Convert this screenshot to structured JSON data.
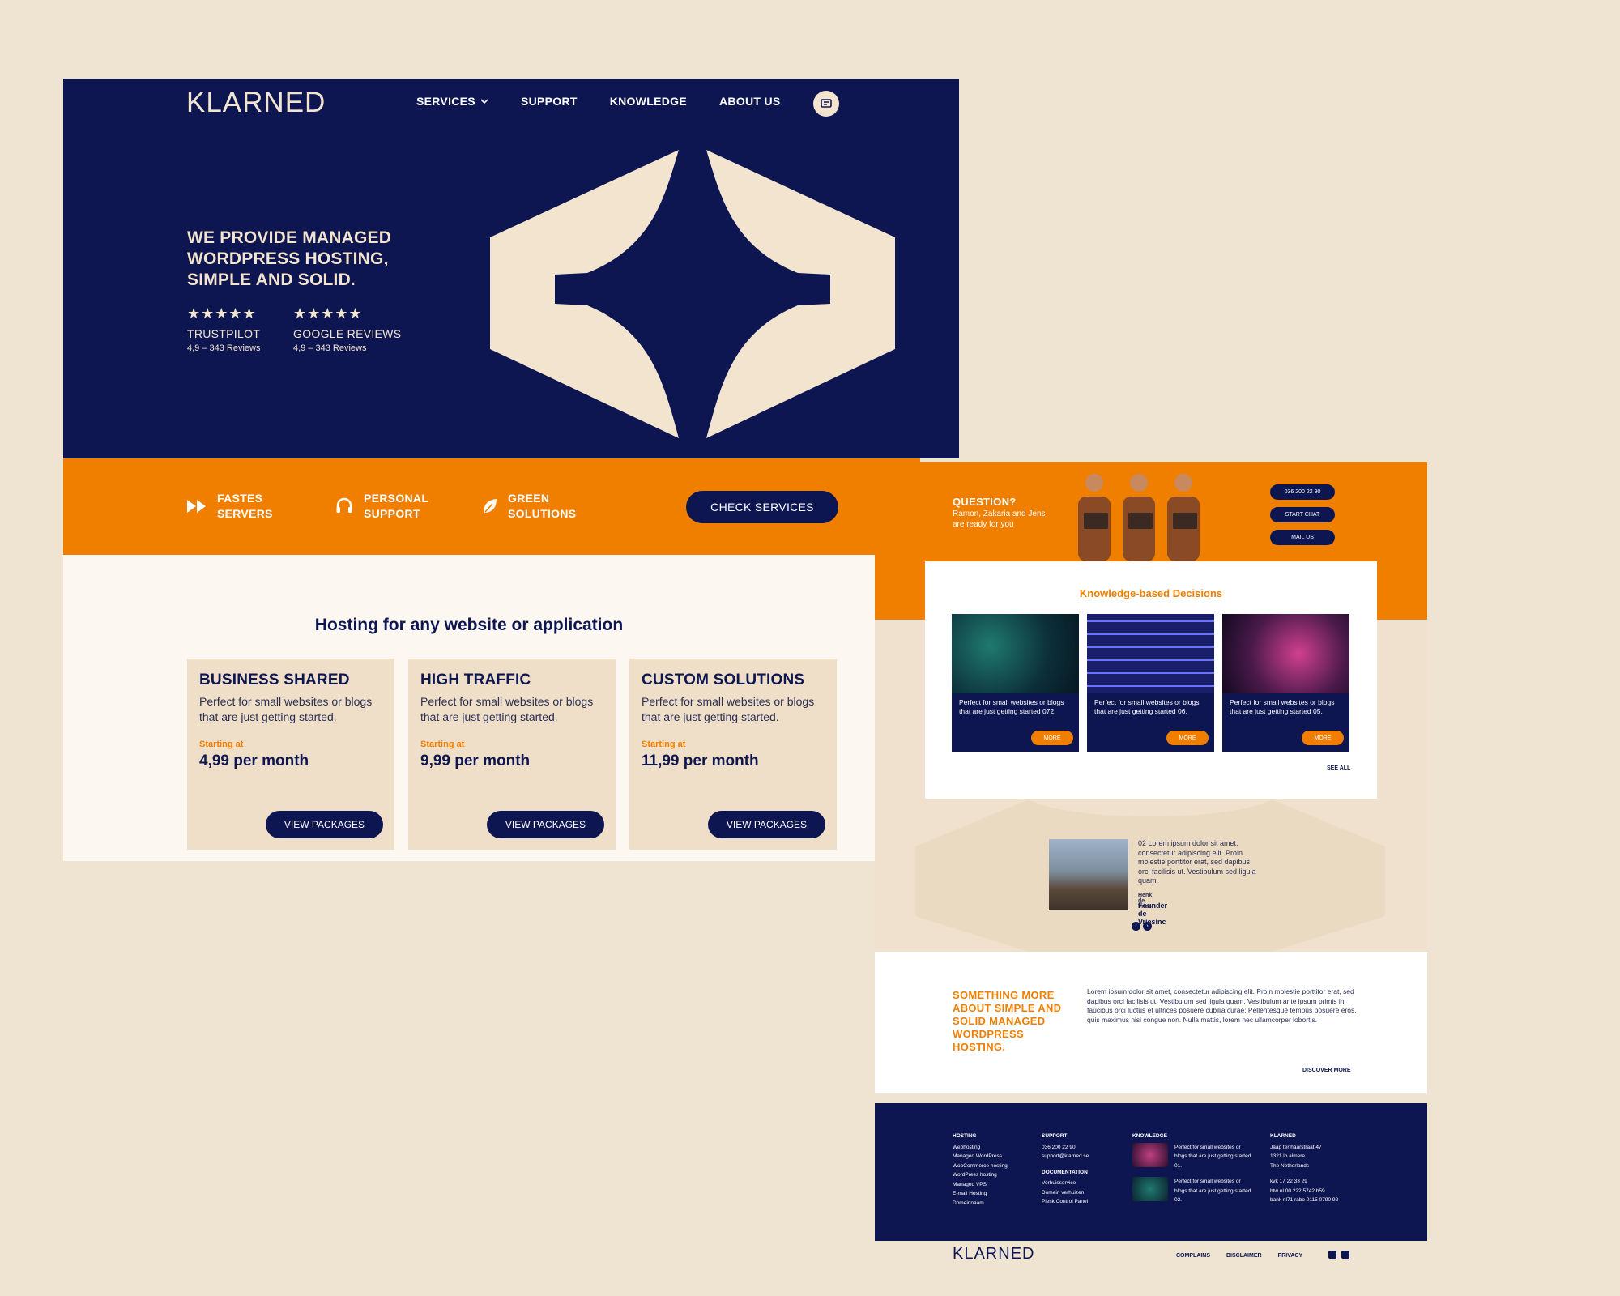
{
  "brand": {
    "name": "KLARNED"
  },
  "colors": {
    "navy": "#0d1650",
    "orange": "#f07f00",
    "cream": "#f2e4cf",
    "background": "#efe3d2"
  },
  "nav": {
    "items": [
      {
        "label": "SERVICES",
        "has_dropdown": true
      },
      {
        "label": "SUPPORT"
      },
      {
        "label": "KNOWLEDGE"
      },
      {
        "label": "ABOUT US"
      }
    ],
    "cart_icon": "cart-icon"
  },
  "hero": {
    "title": "WE PROVIDE MANAGED WORDPRESS HOSTING, SIMPLE AND SOLID.",
    "reviews": [
      {
        "stars": "★★★★★",
        "rating": 5,
        "name": "TRUSTPILOT",
        "count": "4,9 – 343 Reviews"
      },
      {
        "stars": "★★★★★",
        "rating": 5,
        "name": "GOOGLE REVIEWS",
        "count": "4,9 – 343 Reviews"
      }
    ]
  },
  "features": {
    "items": [
      {
        "icon": "fast-forward-icon",
        "line1": "FASTES",
        "line2": "SERVERS"
      },
      {
        "icon": "headset-icon",
        "line1": "PERSONAL",
        "line2": "SUPPORT"
      },
      {
        "icon": "leaf-icon",
        "line1": "GREEN",
        "line2": "SOLUTIONS"
      }
    ],
    "cta": "CHECK SERVICES"
  },
  "hosting": {
    "title": "Hosting for any website or application",
    "cards": [
      {
        "title": "BUSINESS SHARED",
        "desc": "Perfect for small websites or blogs that are just getting started.",
        "starting": "Starting at",
        "price": "4,99 per month",
        "button": "VIEW PACKAGES"
      },
      {
        "title": "HIGH TRAFFIC",
        "desc": "Perfect for small websites or blogs that are just getting started.",
        "starting": "Starting at",
        "price": "9,99 per month",
        "button": "VIEW PACKAGES"
      },
      {
        "title": "CUSTOM SOLUTIONS",
        "desc": "Perfect for small websites or blogs that are just getting started.",
        "starting": "Starting at",
        "price": "11,99 per month",
        "button": "VIEW PACKAGES"
      }
    ]
  },
  "question": {
    "title": "QUESTION?",
    "subtitle": "Ramon, Zakaria and Jens are ready for you",
    "buttons": [
      "036 200 22 90",
      "START CHAT",
      "MAIL US"
    ]
  },
  "knowledge": {
    "title": "Knowledge-based Decisions",
    "items": [
      {
        "text": "Perfect for small websites or blogs that are just getting started 072.",
        "button": "MORE"
      },
      {
        "text": "Perfect for small websites or blogs that are just getting started 06.",
        "button": "MORE"
      },
      {
        "text": "Perfect for small websites or blogs that are just getting started 05.",
        "button": "MORE"
      }
    ],
    "see_all": "SEE ALL"
  },
  "testimonial": {
    "text": "02 Lorem ipsum dolor sit amet, consectetur adipiscing elit. Proin molestie porttitor erat, sed dapibus orci facilisis ut. Vestibulum sed ligula quam.",
    "name": "Henk de Vries",
    "role": "Founder de Vriesinc"
  },
  "about": {
    "title": "SOMETHING MORE ABOUT SIMPLE AND SOLID MANAGED WORDPRESS HOSTING.",
    "text": "Lorem ipsum dolor sit amet, consectetur adipiscing elit. Proin molestie porttitor erat, sed dapibus orci facilisis ut. Vestibulum sed ligula quam. Vestibulum ante ipsum primis in faucibus orci luctus et ultrices posuere cubilia curae; Pellentesque tempus posuere eros, quis maximus nisi congue non. Nulla mattis, lorem nec ullamcorper lobortis.",
    "link": "DISCOVER MORE"
  },
  "footer": {
    "hosting": {
      "title": "HOSTING",
      "links": [
        "Webhosting",
        "Managed WordPress",
        "WooCommerce hosting",
        "WordPress hosting",
        "Managed VPS",
        "E-mail Hosting",
        "Domeinnaam"
      ]
    },
    "support": {
      "title": "SUPPORT",
      "links": [
        "036 200 22 90",
        "support@klarned.se"
      ]
    },
    "documentation": {
      "title": "DOCUMENTATION",
      "links": [
        "Verhuisservice",
        "Domein verhuizen",
        "Plesk Control Panel"
      ]
    },
    "knowledge": {
      "title": "KNOWLEDGE",
      "items": [
        "Perfect for small websites or blogs that are just getting started 01.",
        "Perfect for small websites or blogs that are just getting started 02."
      ]
    },
    "company": {
      "title": "KLARNED",
      "address": [
        "Jaap ter haarstraat 47",
        "1321 lb almere",
        "The Netherlands"
      ],
      "ids": [
        "kvk 17 22 33 29",
        "btw nl 00 222 5742 b59",
        "bank nl71 rabo 0115 0790 92"
      ]
    },
    "legal": [
      "COMPLAINS",
      "DISCLAIMER",
      "PRIVACY"
    ],
    "social": [
      "facebook-icon",
      "instagram-icon"
    ]
  }
}
